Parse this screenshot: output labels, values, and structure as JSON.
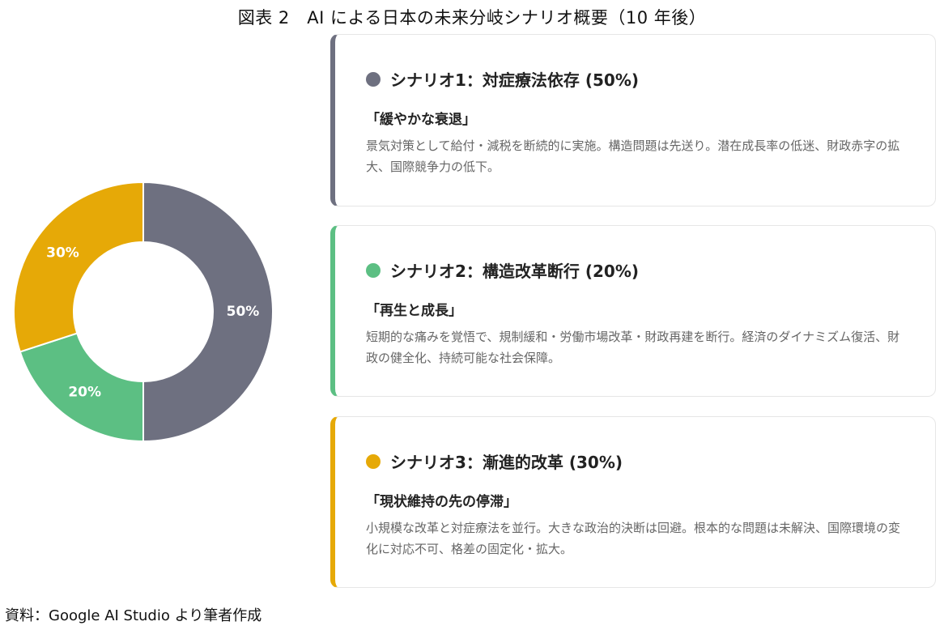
{
  "figure_title": "図表 2　AI による日本の未来分岐シナリオ概要（10 年後）",
  "chart_data": {
    "type": "pie",
    "donut": true,
    "slices": [
      {
        "label": "50%",
        "value": 50,
        "color": "#6e7080"
      },
      {
        "label": "20%",
        "value": 20,
        "color": "#5cbf83"
      },
      {
        "label": "30%",
        "value": 30,
        "color": "#e6a907"
      }
    ]
  },
  "scenarios": [
    {
      "heading": "シナリオ1：対症療法依存 (50%)",
      "subtitle": "「緩やかな衰退」",
      "body": "景気対策として給付・減税を断続的に実施。構造問題は先送り。潜在成長率の低迷、財政赤字の拡大、国際競争力の低下。",
      "color": "#6e7080"
    },
    {
      "heading": "シナリオ2：構造改革断行 (20%)",
      "subtitle": "「再生と成長」",
      "body": "短期的な痛みを覚悟で、規制緩和・労働市場改革・財政再建を断行。経済のダイナミズム復活、財政の健全化、持続可能な社会保障。",
      "color": "#5cbf83"
    },
    {
      "heading": "シナリオ3：漸進的改革 (30%)",
      "subtitle": "「現状維持の先の停滞」",
      "body": "小規模な改革と対症療法を並行。大きな政治的決断は回避。根本的な問題は未解決、国際環境の変化に対応不可、格差の固定化・拡大。",
      "color": "#e6a907"
    }
  ],
  "source": "資料：Google AI Studio より筆者作成"
}
